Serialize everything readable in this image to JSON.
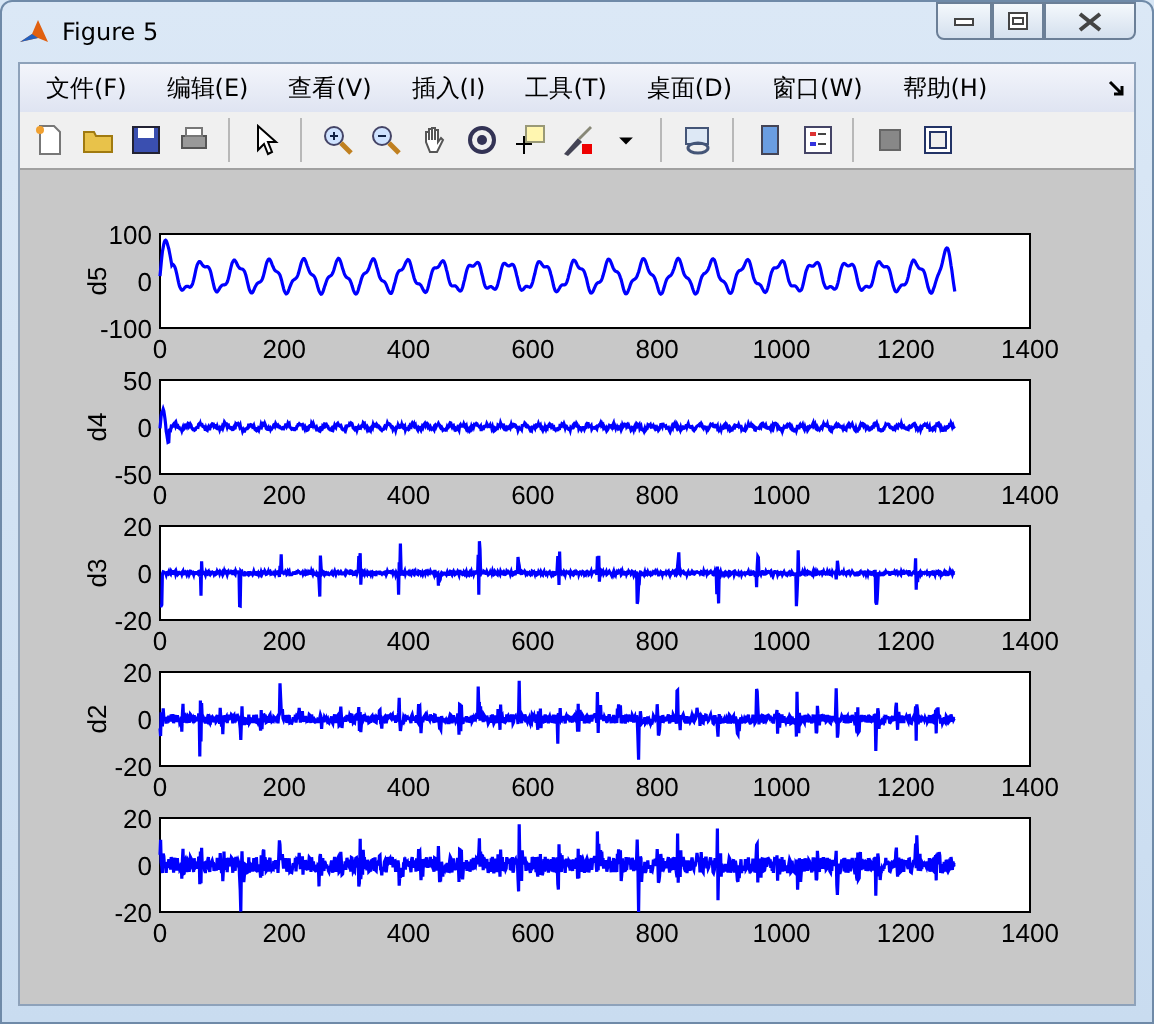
{
  "window": {
    "title": "Figure 5"
  },
  "menu": [
    {
      "label": "文件(F)"
    },
    {
      "label": "编辑(E)"
    },
    {
      "label": "查看(V)"
    },
    {
      "label": "插入(I)"
    },
    {
      "label": "工具(T)"
    },
    {
      "label": "桌面(D)"
    },
    {
      "label": "窗口(W)"
    },
    {
      "label": "帮助(H)"
    }
  ],
  "subplots": [
    {
      "ylabel": "d5",
      "yticks": [
        "100",
        "0",
        "-100"
      ],
      "xticks": [
        "0",
        "200",
        "400",
        "600",
        "800",
        "1000",
        "1200",
        "1400"
      ]
    },
    {
      "ylabel": "d4",
      "yticks": [
        "50",
        "0",
        "-50"
      ],
      "xticks": [
        "0",
        "200",
        "400",
        "600",
        "800",
        "1000",
        "1200",
        "1400"
      ]
    },
    {
      "ylabel": "d3",
      "yticks": [
        "20",
        "0",
        "-20"
      ],
      "xticks": [
        "0",
        "200",
        "400",
        "600",
        "800",
        "1000",
        "1200",
        "1400"
      ]
    },
    {
      "ylabel": "d2",
      "yticks": [
        "20",
        "0",
        "-20"
      ],
      "xticks": [
        "0",
        "200",
        "400",
        "600",
        "800",
        "1000",
        "1200",
        "1400"
      ]
    },
    {
      "yticks": [
        "20",
        "0",
        "-20"
      ],
      "xticks": [
        "0",
        "200",
        "400",
        "600",
        "800",
        "1000",
        "1200",
        "1400"
      ]
    }
  ]
}
